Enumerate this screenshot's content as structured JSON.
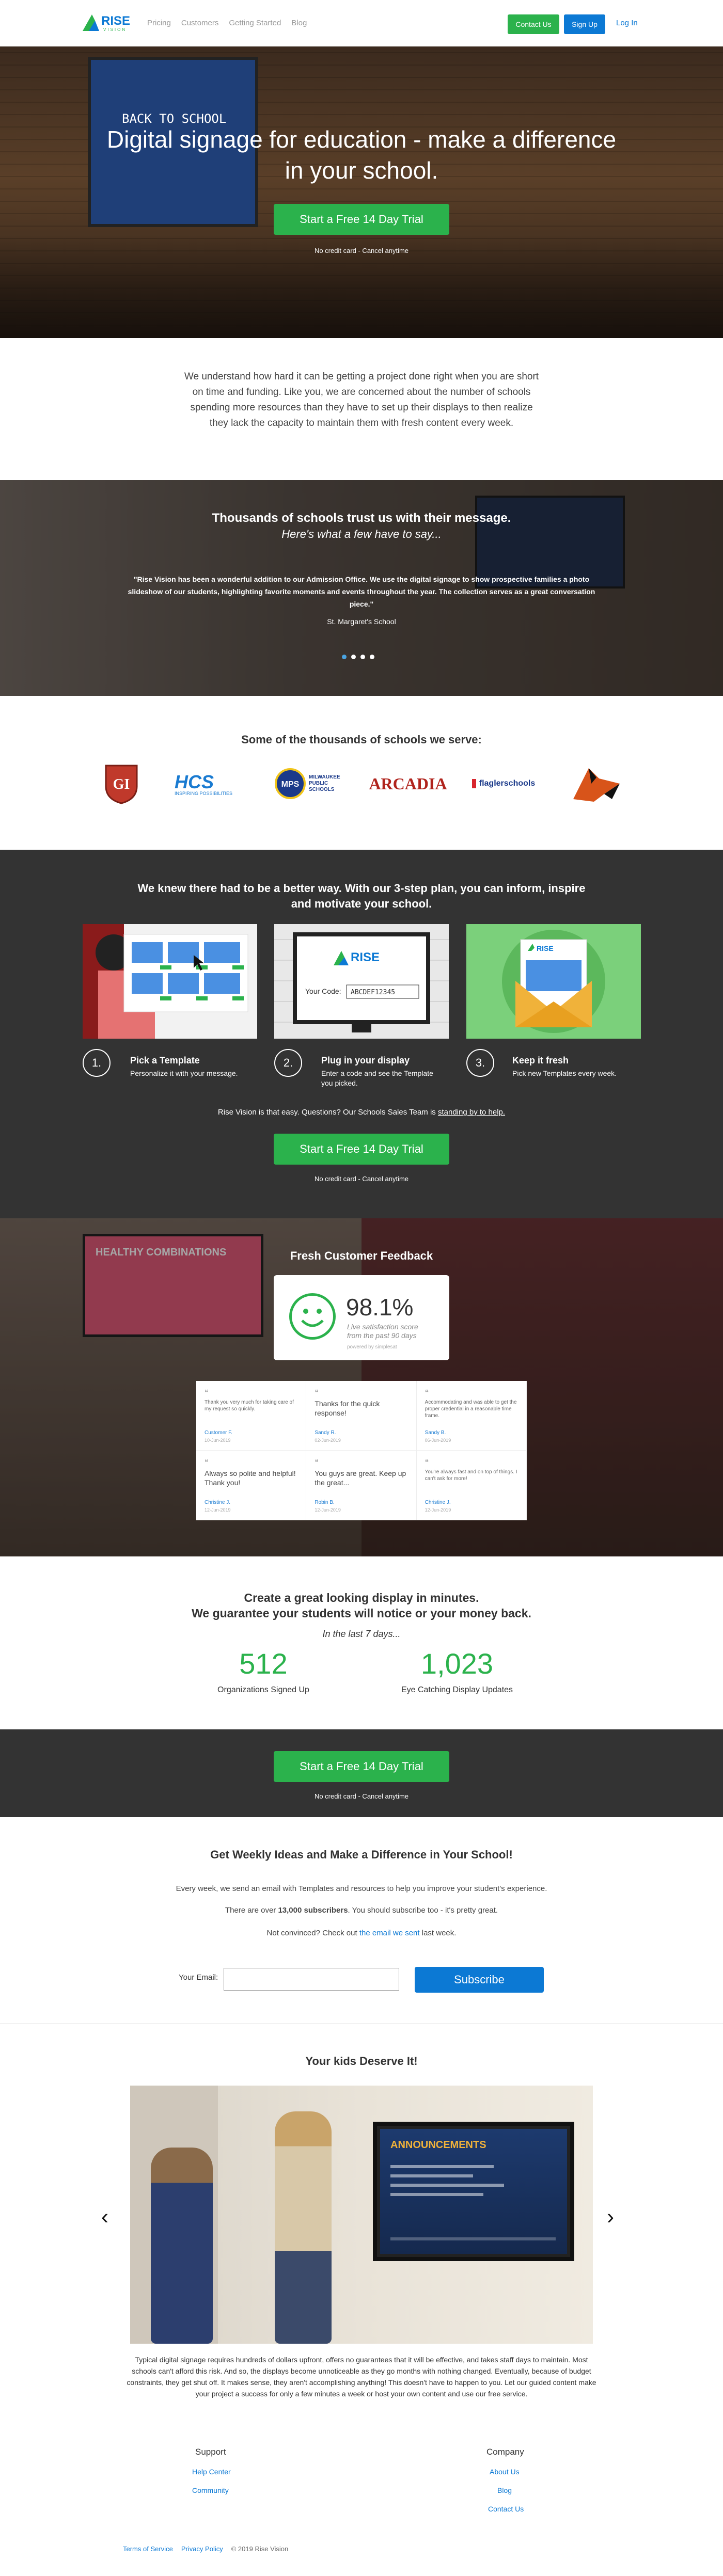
{
  "nav": {
    "logo_text": "RISE",
    "logo_sub": "VISION",
    "links": [
      "Pricing",
      "Customers",
      "Getting Started",
      "Blog"
    ],
    "contact_label": "Contact Us",
    "signup_label": "Sign Up",
    "login_label": "Log In"
  },
  "hero": {
    "sign_text": "BACK TO SCHOOL",
    "title": "Digital signage for education - make a difference in your school.",
    "cta_label": "Start a Free 14 Day Trial",
    "note": "No credit card - Cancel anytime"
  },
  "intro": {
    "text": "We understand how hard it can be getting a project done right when you are short on time and funding. Like you, we are concerned about the number of schools spending more resources than they have to set up their displays to then realize they lack the capacity to maintain them with fresh content every week."
  },
  "testimonials": {
    "title": "Thousands of schools trust us with their message.",
    "subtitle": "Here's what a few have to say...",
    "quote": "\"Rise Vision has been a wonderful addition to our Admission Office. We use the digital signage to show prospective families a photo slideshow of our students, highlighting favorite moments and events throughout the year. The collection serves as a great conversation piece.\"",
    "author": "St. Margaret's School",
    "dots": 4,
    "active_dot": 1
  },
  "schools": {
    "title": "Some of the thousands of schools we serve:",
    "logos": [
      "GI",
      "HCS",
      "MPS",
      "ARCADIA",
      "fsd",
      "fox"
    ],
    "hcs_text": "INSPIRING POSSIBILITIES",
    "mps_text": "MILWAUKEE PUBLIC SCHOOLS",
    "fsd_text": "flaglerschools"
  },
  "steps": {
    "title": "We knew there had to be a better way. With our 3-step plan, you can inform, inspire and motivate your school.",
    "items": [
      {
        "num": "1.",
        "title": "Pick a Template",
        "desc": "Personalize it with your message."
      },
      {
        "num": "2.",
        "title": "Plug in your display",
        "desc": "Enter a code and see the Template you picked."
      },
      {
        "num": "3.",
        "title": "Keep it fresh",
        "desc": "Pick new Templates every week."
      }
    ],
    "code_label": "Your Code:",
    "code_value": "ABCDEF12345",
    "note_prefix": "Rise Vision is that easy. Questions? Our Schools Sales Team is ",
    "note_link": "standing by to help.",
    "cta_label": "Start a Free 14 Day Trial",
    "cta_note": "No credit card - Cancel anytime"
  },
  "feedback": {
    "tv_text": "HEALTHY COMBINATIONS",
    "title": "Fresh Customer Feedback",
    "score": "98.1%",
    "score_sub_1": "Live satisfaction score",
    "score_sub_2": "from the past 90 days",
    "powered": "powered by simplesat",
    "cards": [
      {
        "text": "Thank you very much for taking care of my request so quickly.",
        "small": true,
        "name": "Customer F.",
        "date": "10-Jun-2019"
      },
      {
        "text": "Thanks for the quick response!",
        "small": false,
        "name": "Sandy R.",
        "date": "02-Jun-2019"
      },
      {
        "text": "Accommodating and was able to get the proper credential in a reasonable time frame.",
        "small": true,
        "name": "Sandy B.",
        "date": "06-Jun-2019"
      },
      {
        "text": "Always so polite and helpful! Thank you!",
        "small": false,
        "name": "Christine J.",
        "date": "12-Jun-2019"
      },
      {
        "text": "You guys are great. Keep up the great...",
        "small": false,
        "name": "Robin B.",
        "date": "12-Jun-2019"
      },
      {
        "text": "You're always fast and on top of things. I can't ask for more!",
        "small": true,
        "name": "Christine J.",
        "date": "12-Jun-2019"
      }
    ]
  },
  "stats": {
    "title_1": "Create a great looking display in minutes.",
    "title_2": "We guarantee your students will notice or your money back.",
    "sub": "In the last 7 days...",
    "items": [
      {
        "value": "512",
        "label": "Organizations Signed Up"
      },
      {
        "value": "1,023",
        "label": "Eye Catching Display Updates"
      }
    ]
  },
  "cta2": {
    "label": "Start a Free 14 Day Trial",
    "note": "No credit card - Cancel anytime"
  },
  "newsletter": {
    "title": "Get Weekly Ideas and Make a Difference in Your School!",
    "p1": "Every week, we send an email with Templates and resources to help you improve your student's experience.",
    "p2_a": "There are over ",
    "p2_b": "13,000 subscribers",
    "p2_c": ". You should subscribe too - it's pretty great.",
    "p3_a": "Not convinced? Check out ",
    "p3_link": "the email we sent",
    "p3_c": " last week.",
    "email_label": "Your Email:",
    "email_value": "",
    "subscribe_label": "Subscribe"
  },
  "kids": {
    "title": "Your kids Deserve It!",
    "screen_title": "ANNOUNCEMENTS",
    "prev": "‹",
    "next": "›",
    "text": "Typical digital signage requires hundreds of dollars upfront, offers no guarantees that it will be effective, and takes staff days to maintain. Most schools can't afford this risk. And so, the displays become unnoticeable as they go months with nothing changed. Eventually, because of budget constraints, they get shut off. It makes sense, they aren't accomplishing anything! This doesn't have to happen to you. Let our guided content make your project a success for only a few minutes a week or host your own content and use our free service."
  },
  "footer": {
    "support_title": "Support",
    "support_links": [
      "Help Center",
      "Community"
    ],
    "company_title": "Company",
    "company_links": [
      "About Us",
      "Blog",
      "Contact Us"
    ],
    "terms": "Terms of Service",
    "privacy": "Privacy Policy",
    "copyright": "© 2019 Rise Vision"
  },
  "colors": {
    "green": "#2bb24c",
    "blue": "#0c79d4",
    "dark": "#333333"
  }
}
